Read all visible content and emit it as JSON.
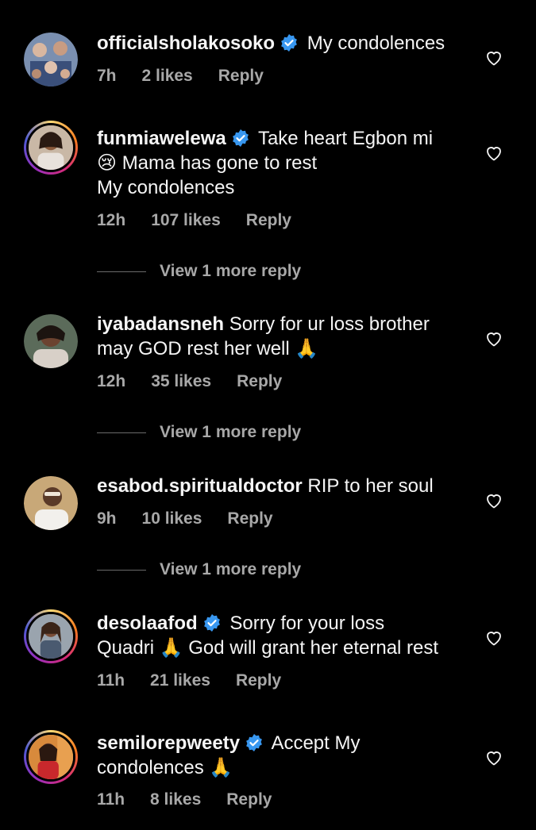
{
  "comments": [
    {
      "username": "officialsholakosoko",
      "verified": true,
      "lines": [
        "My condolences"
      ],
      "time": "7h",
      "likes": "2 likes",
      "reply": "Reply"
    },
    {
      "username": "funmiawelewa",
      "verified": true,
      "lines": [
        "Take heart Egbon mi",
        "😢 Mama has gone to rest",
        "My condolences"
      ],
      "time": "12h",
      "likes": "107 likes",
      "reply": "Reply",
      "more_replies": "View 1 more reply"
    },
    {
      "username": "iyabadansneh",
      "verified": false,
      "lines": [
        "Sorry for ur loss brother",
        "may GOD rest her well 🙏"
      ],
      "time": "12h",
      "likes": "35 likes",
      "reply": "Reply",
      "more_replies": "View 1 more reply"
    },
    {
      "username": "esabod.spiritualdoctor",
      "verified": false,
      "lines": [
        "RIP to her soul"
      ],
      "time": "9h",
      "likes": "10 likes",
      "reply": "Reply",
      "more_replies": "View 1 more reply"
    },
    {
      "username": "desolaafod",
      "verified": true,
      "lines": [
        "Sorry for your loss",
        "Quadri 🙏 God will grant her eternal rest"
      ],
      "time": "11h",
      "likes": "21 likes",
      "reply": "Reply"
    },
    {
      "username": "semilorepweety",
      "verified": true,
      "lines": [
        "Accept My",
        "condolences 🙏"
      ],
      "time": "11h",
      "likes": "8 likes",
      "reply": "Reply"
    }
  ],
  "icons": {
    "heart": "heart-outline-icon",
    "verified": "verified-badge-icon"
  },
  "colors": {
    "background": "#000000",
    "text": "#f5f5f5",
    "muted": "#a8a8a8",
    "verified": "#3897f0"
  }
}
